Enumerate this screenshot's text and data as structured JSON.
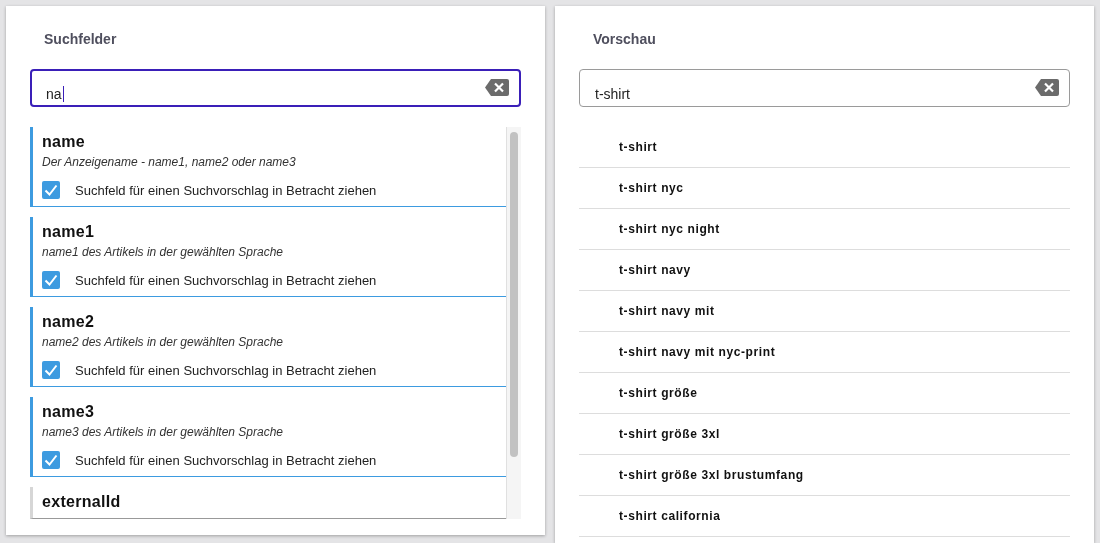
{
  "fields_panel": {
    "title": "Suchfelder",
    "search": {
      "value": "na"
    },
    "items": [
      {
        "name": "name",
        "description": "Der Anzeigename - name1, name2 oder name3",
        "option": "Suchfeld für einen Suchvorschlag in Betracht ziehen",
        "checked": true
      },
      {
        "name": "name1",
        "description": "name1 des Artikels in der gewählten Sprache",
        "option": "Suchfeld für einen Suchvorschlag in Betracht ziehen",
        "checked": true
      },
      {
        "name": "name2",
        "description": "name2 des Artikels in der gewählten Sprache",
        "option": "Suchfeld für einen Suchvorschlag in Betracht ziehen",
        "checked": true
      },
      {
        "name": "name3",
        "description": "name3 des Artikels in der gewählten Sprache",
        "option": "Suchfeld für einen Suchvorschlag in Betracht ziehen",
        "checked": true
      },
      {
        "name": "externalId",
        "checked": false
      }
    ]
  },
  "preview_panel": {
    "title": "Vorschau",
    "search": {
      "value": "t-shirt"
    },
    "suggestions": [
      "t-shirt",
      "t-shirt nyc",
      "t-shirt nyc night",
      "t-shirt navy",
      "t-shirt navy mit",
      "t-shirt navy mit nyc-print",
      "t-shirt größe",
      "t-shirt größe 3xl",
      "t-shirt größe 3xl brustumfang",
      "t-shirt california"
    ]
  }
}
